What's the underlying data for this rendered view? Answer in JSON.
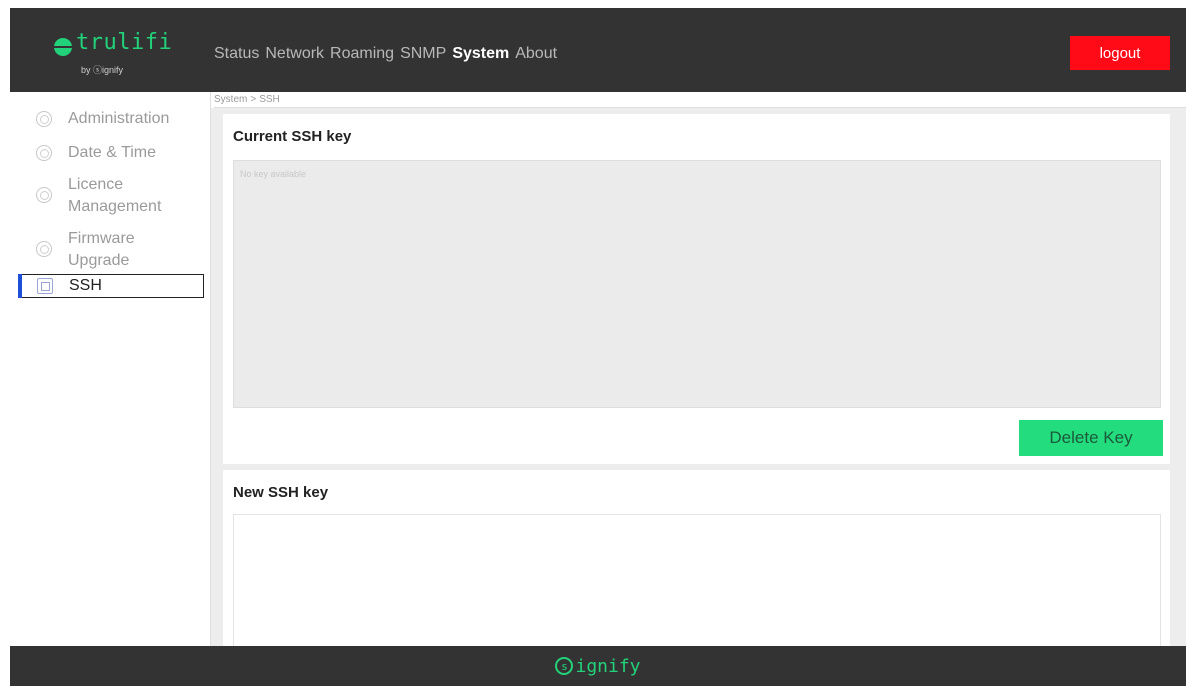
{
  "brand": {
    "name": "trulifi",
    "sub": "by ⓢignify"
  },
  "nav": [
    {
      "label": "Status",
      "active": false
    },
    {
      "label": "Network",
      "active": false
    },
    {
      "label": "Roaming",
      "active": false
    },
    {
      "label": "SNMP",
      "active": false
    },
    {
      "label": "System",
      "active": true
    },
    {
      "label": "About",
      "active": false
    }
  ],
  "logout_label": "logout",
  "sidebar": {
    "items": [
      {
        "label": "Administration",
        "icon": "gear-icon"
      },
      {
        "label": "Date & Time",
        "icon": "clock-icon"
      },
      {
        "label": "Licence\nManagement",
        "icon": "license-icon"
      },
      {
        "label": "Firmware\nUpgrade",
        "icon": "refresh-icon"
      },
      {
        "label": "SSH",
        "icon": "key-grid-icon",
        "active": true
      }
    ]
  },
  "breadcrumb": {
    "parent": "System",
    "separator": ">",
    "current": "SSH"
  },
  "current_key": {
    "title": "Current SSH key",
    "placeholder": "No key available",
    "delete_label": "Delete Key"
  },
  "new_key": {
    "title": "New SSH key"
  },
  "footer": {
    "logo_letter": "s",
    "logo_text": "ignify"
  },
  "colors": {
    "header_bg": "#333333",
    "accent_green": "#22d27a",
    "logout_red": "#ff0a16",
    "delete_green": "#22dc7e",
    "active_marker": "#1e4fd8"
  }
}
